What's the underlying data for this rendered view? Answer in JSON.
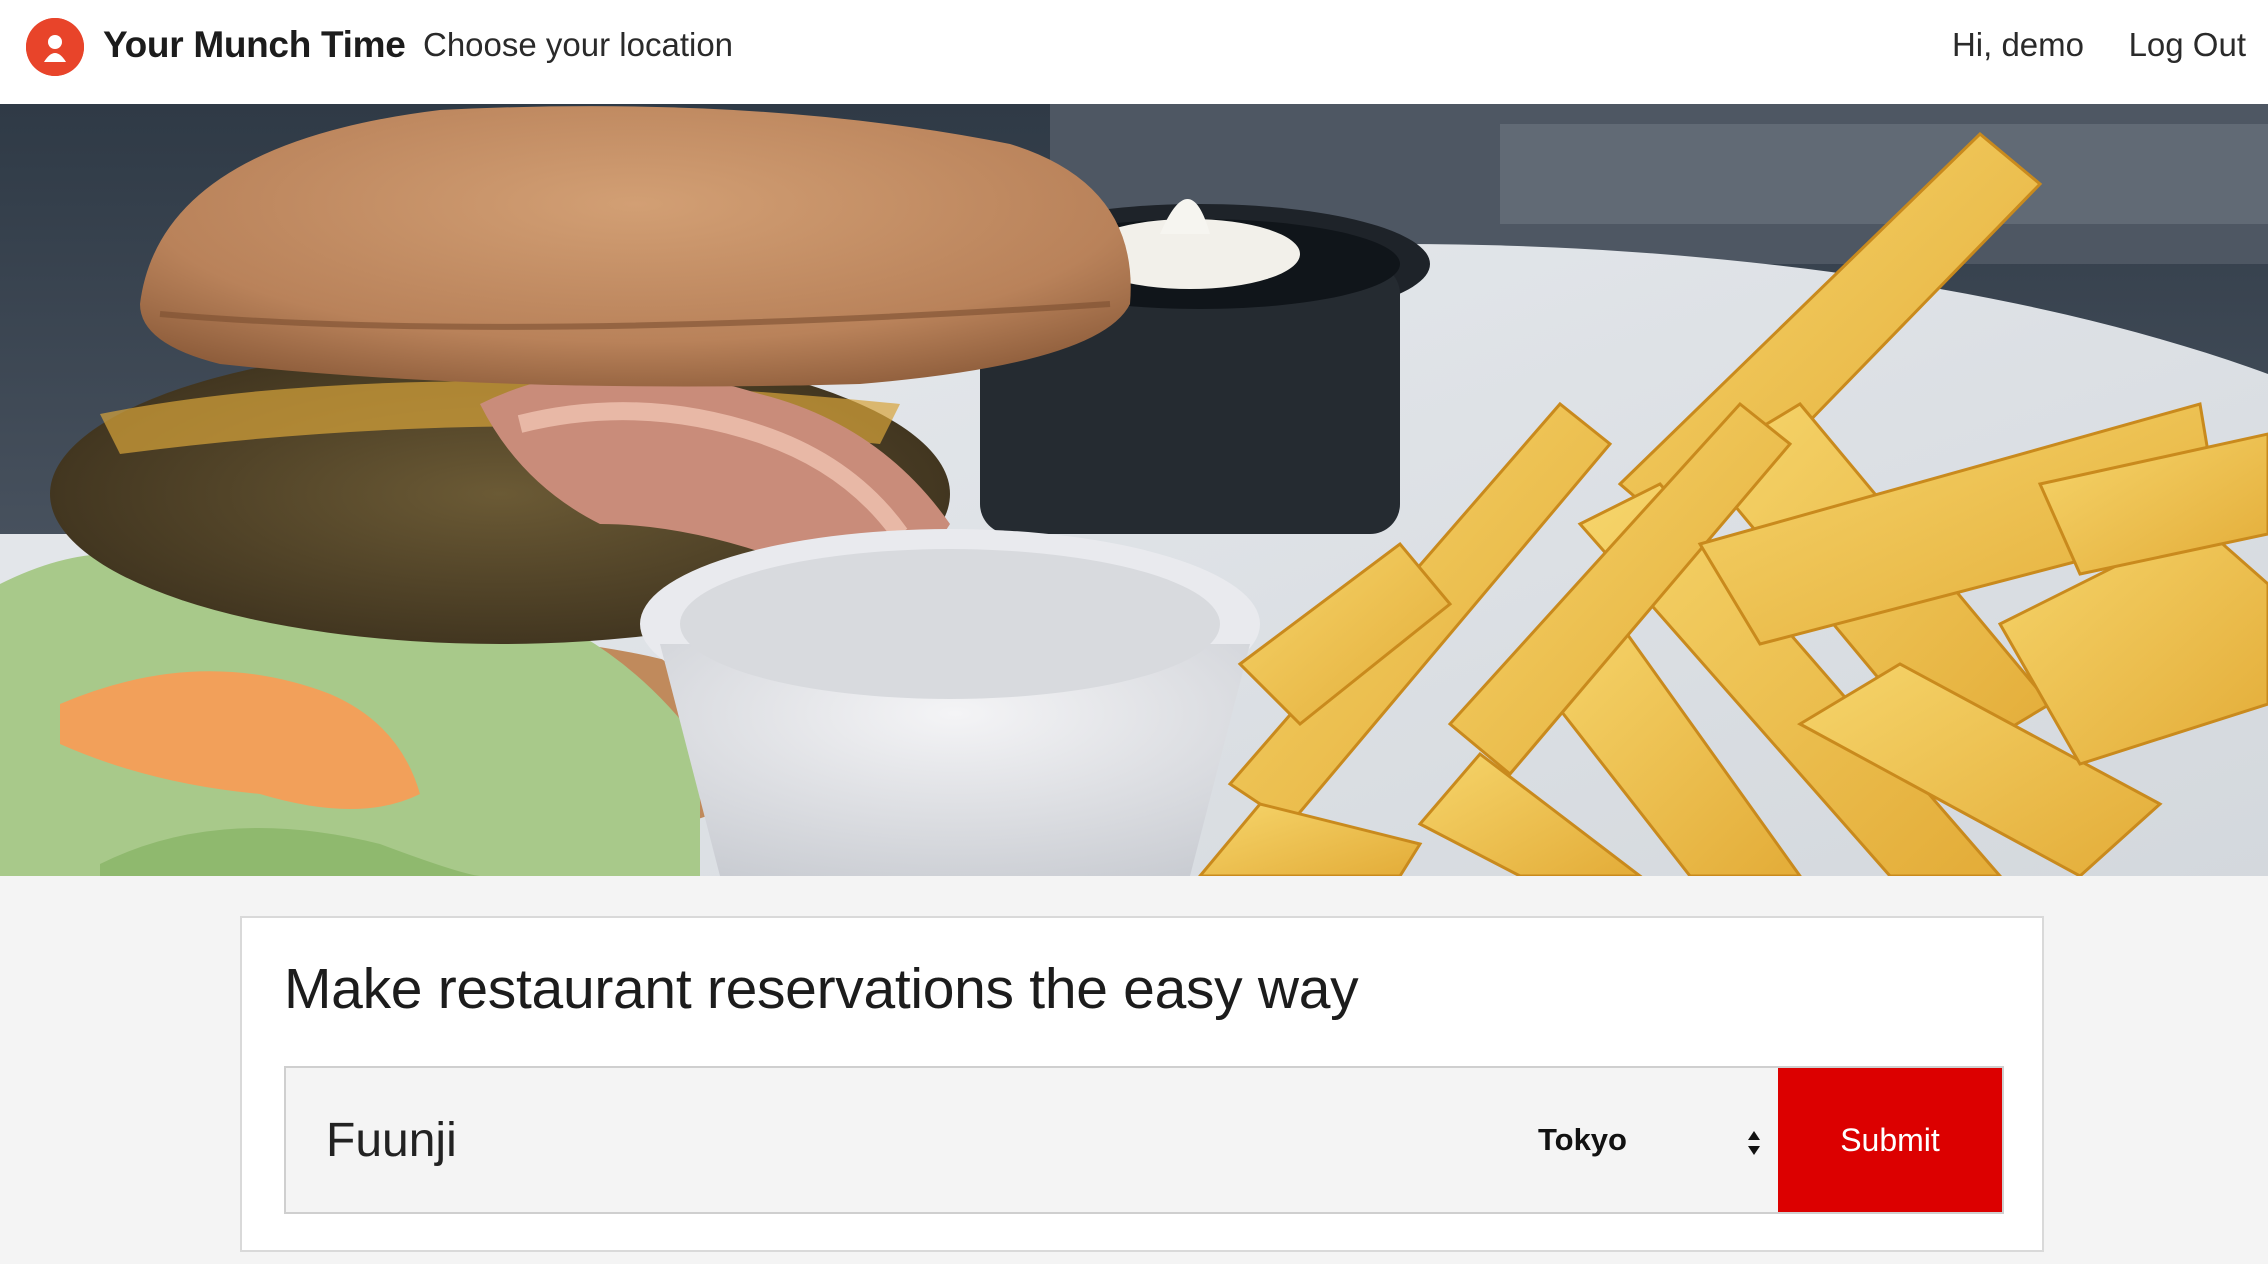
{
  "nav": {
    "brand": "Your Munch Time",
    "location_link": "Choose your location",
    "greeting": "Hi, demo",
    "logout": "Log Out"
  },
  "hero": {
    "image_subject": "burger and fries"
  },
  "search": {
    "heading": "Make restaurant reservations the easy way",
    "query_value": "Fuunji",
    "city_selected": "Tokyo",
    "submit_label": "Submit"
  },
  "colors": {
    "brand_red": "#e8442a",
    "submit_red": "#dc0000",
    "card_bg": "#ffffff",
    "page_bg": "#f4f4f4"
  }
}
